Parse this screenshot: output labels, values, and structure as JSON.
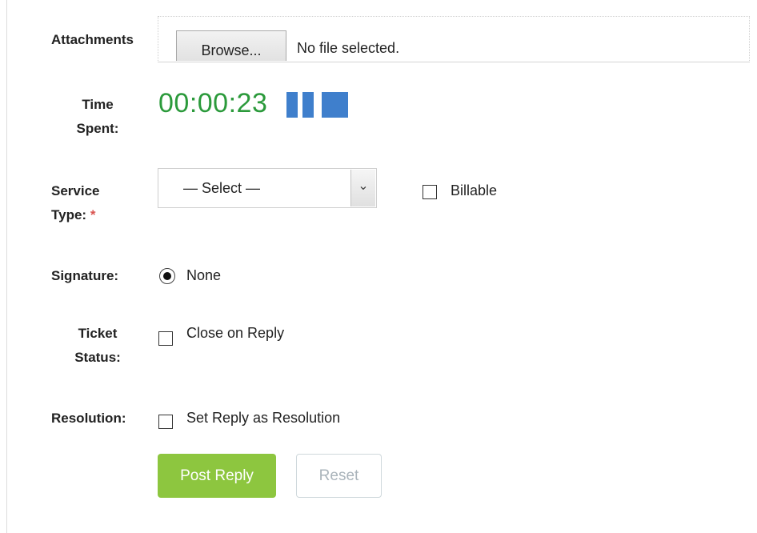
{
  "attachments": {
    "label": "Attachments",
    "browse_label": "Browse...",
    "status_text": "No file selected."
  },
  "time_spent": {
    "label_line1": "Time",
    "label_line2": "Spent:",
    "value": "00:00:23",
    "pause_icon": "pause-icon",
    "stop_icon": "stop-icon",
    "timer_color": "#2b9a3b",
    "icon_color": "#3f7fcc"
  },
  "service_type": {
    "label_line1": "Service",
    "label_line2": "Type:",
    "required_mark": "*",
    "selected": "— Select —",
    "billable_label": "Billable",
    "billable_checked": false
  },
  "signature": {
    "label": "Signature:",
    "option_label": "None",
    "selected": true
  },
  "ticket_status": {
    "label_line1": "Ticket",
    "label_line2": "Status:",
    "option_label": "Close on Reply",
    "checked": false
  },
  "resolution": {
    "label": "Resolution:",
    "option_label": "Set Reply as Resolution",
    "checked": false
  },
  "actions": {
    "post_label": "Post Reply",
    "reset_label": "Reset",
    "post_color": "#8dc63f"
  }
}
